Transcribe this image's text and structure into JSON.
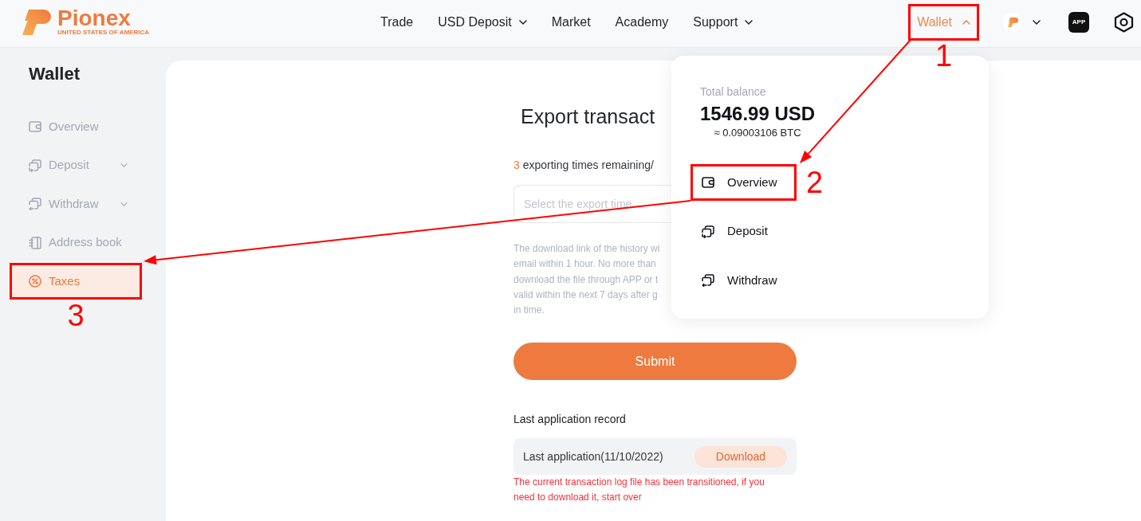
{
  "header": {
    "logo": {
      "name": "Pionex",
      "tagline": "UNITED STATES OF AMERICA"
    },
    "nav": [
      {
        "label": "Trade",
        "has_menu": false
      },
      {
        "label": "USD Deposit",
        "has_menu": true
      },
      {
        "label": "Market",
        "has_menu": false
      },
      {
        "label": "Academy",
        "has_menu": false
      },
      {
        "label": "Support",
        "has_menu": true
      }
    ],
    "wallet_menu": {
      "label": "Wallet",
      "expanded": true,
      "callout": "1"
    },
    "app_label": "APP"
  },
  "sidebar": {
    "title": "Wallet",
    "items": [
      {
        "label": "Overview",
        "has_menu": false,
        "selected": false
      },
      {
        "label": "Deposit",
        "has_menu": true,
        "selected": false
      },
      {
        "label": "Withdraw",
        "has_menu": true,
        "selected": false
      },
      {
        "label": "Address book",
        "has_menu": false,
        "selected": false
      },
      {
        "label": "Taxes",
        "has_menu": false,
        "selected": true,
        "callout": "3"
      }
    ]
  },
  "export_panel": {
    "title": "Export transact",
    "remaining_count": "3",
    "remaining_text": "exporting times remaining/",
    "select_placeholder": "Select the export time",
    "note_lines": [
      "The download link of the history wi",
      "email within 1 hour. No more than",
      "download the file through APP or t",
      "valid within the next 7 days after g",
      "in time."
    ],
    "submit": "Submit",
    "record_heading": "Last application record",
    "record": {
      "label": "Last application(11/10/2022)",
      "download": "Download",
      "download_disabled": true
    },
    "error": "The current transaction log file has been transitioned, if you need to download it, start over"
  },
  "wallet_dropdown": {
    "balance_label": "Total balance",
    "balance": "1546.99 USD",
    "balance_btc": "≈ 0.09003106 BTC",
    "items": [
      {
        "label": "Overview",
        "callout": "2"
      },
      {
        "label": "Deposit"
      },
      {
        "label": "Withdraw"
      }
    ]
  }
}
